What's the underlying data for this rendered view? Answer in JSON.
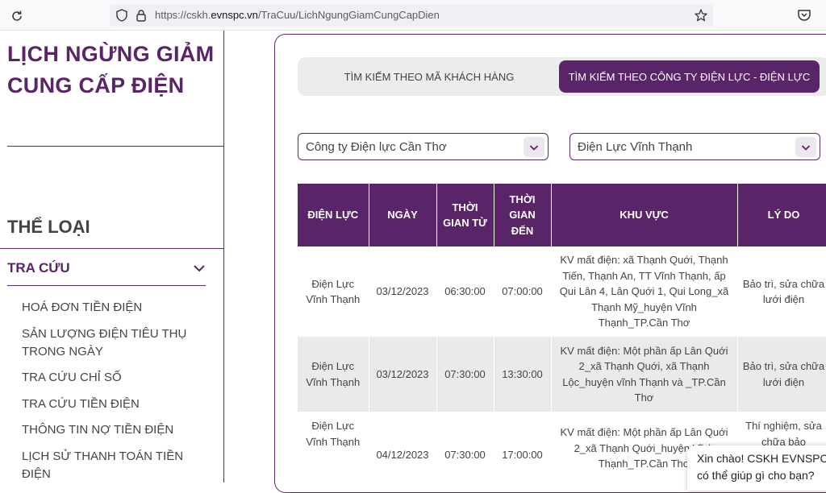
{
  "browser": {
    "url_prefix": "https://cskh.",
    "url_host": "evnspc.vn",
    "url_path": "/TraCuu/LichNgungGiamCungCapDien"
  },
  "sidebar": {
    "title": "LỊCH NGỪNG GIẢM CUNG CẤP ĐIỆN",
    "category_heading": "THỂ LOẠI",
    "section_label": "TRA CỨU",
    "items": [
      "HOÁ ĐƠN TIỀN ĐIỆN",
      "SẢN LƯỢNG ĐIỆN TIÊU THỤ TRONG NGÀY",
      "TRA CỨU CHỈ SỐ",
      "TRA CỨU TIỀN ĐIỆN",
      "THÔNG TIN NỢ TIỀN ĐIỆN",
      "LỊCH SỬ THANH TOÁN TIỀN ĐIỆN"
    ]
  },
  "tabs": {
    "by_customer": "TÌM KIẾM THEO MÃ KHÁCH HÀNG",
    "by_company": "TÌM KIẾM THEO CÔNG TY ĐIỆN LỰC - ĐIỆN LỰC"
  },
  "filters": {
    "company": "Công ty Điện lực Cần Thơ",
    "branch": "Điện Lực Vĩnh Thạnh"
  },
  "table": {
    "headers": [
      "ĐIỆN LỰC",
      "NGÀY",
      "THỜI GIAN TỪ",
      "THỜI GIAN ĐẾN",
      "KHU VỰC",
      "LÝ DO"
    ],
    "rows": [
      {
        "unit": "Điện Lực Vĩnh Thạnh",
        "date": "03/12/2023",
        "from": "06:30:00",
        "to": "07:00:00",
        "area": "KV mất điện: xã Thạnh Quới, Thạnh Tiến, Thạnh An, TT Vĩnh Thạnh, ấp Qui Lân 4, Lân Quới 1, Qui Long_xã Thạnh Mỹ_huyện Vĩnh Thạnh_TP.Cần Thơ",
        "reason": "Bảo trì, sửa chữa lưới điện"
      },
      {
        "unit": "Điện Lực Vĩnh Thạnh",
        "date": "03/12/2023",
        "from": "07:30:00",
        "to": "13:30:00",
        "area": "KV mất điện: Một phần ấp Lân Quới 2_xã Thạnh Quới, xã Thạnh Lộc_huyện vĩnh Thạnh và _TP.Cần Thơ",
        "reason": "Bảo trì, sửa chữa lưới điện"
      },
      {
        "unit": "Điện Lực Vĩnh Thạnh",
        "date": "04/12/2023",
        "from": "07:30:00",
        "to": "17:00:00",
        "area": "KV mất điện: Một phần ấp Lân Quới 2_xã Thạnh Quới_huyện Vĩnh Thạnh_TP.Cần Thơ",
        "reason": "Thí nghiệm, sửa chữa bảo"
      }
    ]
  },
  "chat": {
    "line1": "Xin chào! CSKH EVNSPC",
    "line2": "có thể giúp gì cho bạn?"
  }
}
